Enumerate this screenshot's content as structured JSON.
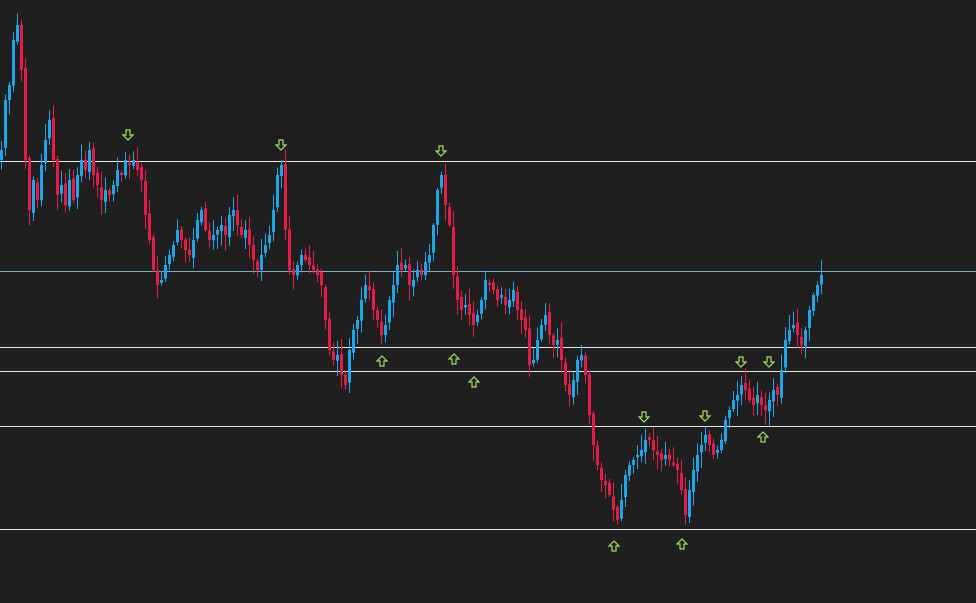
{
  "chart_data": {
    "type": "candlestick",
    "colors": {
      "background": "#1f1f1f",
      "bull": "#1ea7e8",
      "bear": "#e11d48",
      "level_line": "#e6e6e6",
      "mid_line": "#7fb0c8",
      "arrow": "#9fe35b"
    },
    "ylim": [
      0,
      603
    ],
    "horizontal_levels": [
      {
        "y": 161,
        "kind": "resistance"
      },
      {
        "y": 271,
        "kind": "mid"
      },
      {
        "y": 347,
        "kind": "support"
      },
      {
        "y": 371,
        "kind": "support"
      },
      {
        "y": 426,
        "kind": "support"
      },
      {
        "y": 529,
        "kind": "support"
      }
    ],
    "fractal_arrows": [
      {
        "x": 128,
        "y": 135,
        "dir": "down"
      },
      {
        "x": 281,
        "y": 145,
        "dir": "down"
      },
      {
        "x": 441,
        "y": 151,
        "dir": "down"
      },
      {
        "x": 382,
        "y": 361,
        "dir": "up"
      },
      {
        "x": 454,
        "y": 359,
        "dir": "up"
      },
      {
        "x": 474,
        "y": 382,
        "dir": "up"
      },
      {
        "x": 644,
        "y": 417,
        "dir": "down"
      },
      {
        "x": 705,
        "y": 416,
        "dir": "down"
      },
      {
        "x": 741,
        "y": 362,
        "dir": "down"
      },
      {
        "x": 769,
        "y": 362,
        "dir": "down"
      },
      {
        "x": 763,
        "y": 437,
        "dir": "up"
      },
      {
        "x": 614,
        "y": 546,
        "dir": "up"
      },
      {
        "x": 682,
        "y": 544,
        "dir": "up"
      }
    ],
    "price_path": [
      [
        0,
        150
      ],
      [
        4,
        100
      ],
      [
        8,
        85
      ],
      [
        12,
        40
      ],
      [
        16,
        25
      ],
      [
        20,
        70
      ],
      [
        24,
        160
      ],
      [
        28,
        210
      ],
      [
        32,
        180
      ],
      [
        36,
        200
      ],
      [
        40,
        165
      ],
      [
        44,
        140
      ],
      [
        48,
        120
      ],
      [
        52,
        160
      ],
      [
        56,
        195
      ],
      [
        60,
        185
      ],
      [
        64,
        205
      ],
      [
        68,
        180
      ],
      [
        72,
        200
      ],
      [
        76,
        175
      ],
      [
        80,
        160
      ],
      [
        84,
        170
      ],
      [
        88,
        150
      ],
      [
        92,
        175
      ],
      [
        96,
        185
      ],
      [
        100,
        200
      ],
      [
        104,
        190
      ],
      [
        108,
        195
      ],
      [
        112,
        185
      ],
      [
        116,
        170
      ],
      [
        120,
        175
      ],
      [
        124,
        160
      ],
      [
        128,
        165
      ],
      [
        132,
        160
      ],
      [
        136,
        170
      ],
      [
        140,
        180
      ],
      [
        144,
        215
      ],
      [
        148,
        240
      ],
      [
        152,
        270
      ],
      [
        156,
        285
      ],
      [
        160,
        280
      ],
      [
        164,
        265
      ],
      [
        168,
        255
      ],
      [
        172,
        245
      ],
      [
        176,
        230
      ],
      [
        180,
        240
      ],
      [
        184,
        250
      ],
      [
        188,
        255
      ],
      [
        192,
        240
      ],
      [
        196,
        220
      ],
      [
        200,
        210
      ],
      [
        204,
        230
      ],
      [
        208,
        240
      ],
      [
        212,
        235
      ],
      [
        216,
        230
      ],
      [
        220,
        225
      ],
      [
        224,
        235
      ],
      [
        228,
        215
      ],
      [
        232,
        210
      ],
      [
        236,
        225
      ],
      [
        240,
        235
      ],
      [
        244,
        230
      ],
      [
        248,
        245
      ],
      [
        252,
        260
      ],
      [
        256,
        270
      ],
      [
        260,
        255
      ],
      [
        264,
        245
      ],
      [
        268,
        235
      ],
      [
        272,
        210
      ],
      [
        276,
        175
      ],
      [
        280,
        165
      ],
      [
        284,
        230
      ],
      [
        288,
        270
      ],
      [
        292,
        275
      ],
      [
        296,
        265
      ],
      [
        300,
        255
      ],
      [
        304,
        260
      ],
      [
        308,
        265
      ],
      [
        312,
        270
      ],
      [
        316,
        275
      ],
      [
        320,
        285
      ],
      [
        324,
        320
      ],
      [
        328,
        350
      ],
      [
        332,
        360
      ],
      [
        336,
        355
      ],
      [
        340,
        375
      ],
      [
        344,
        385
      ],
      [
        348,
        350
      ],
      [
        352,
        330
      ],
      [
        356,
        320
      ],
      [
        360,
        300
      ],
      [
        364,
        285
      ],
      [
        368,
        290
      ],
      [
        372,
        310
      ],
      [
        376,
        320
      ],
      [
        380,
        335
      ],
      [
        384,
        325
      ],
      [
        388,
        300
      ],
      [
        392,
        285
      ],
      [
        396,
        265
      ],
      [
        400,
        270
      ],
      [
        404,
        265
      ],
      [
        408,
        285
      ],
      [
        412,
        280
      ],
      [
        416,
        270
      ],
      [
        420,
        275
      ],
      [
        424,
        262
      ],
      [
        428,
        255
      ],
      [
        432,
        225
      ],
      [
        436,
        190
      ],
      [
        440,
        175
      ],
      [
        444,
        205
      ],
      [
        448,
        225
      ],
      [
        452,
        275
      ],
      [
        456,
        300
      ],
      [
        460,
        310
      ],
      [
        464,
        305
      ],
      [
        468,
        315
      ],
      [
        472,
        325
      ],
      [
        476,
        315
      ],
      [
        480,
        300
      ],
      [
        484,
        280
      ],
      [
        488,
        285
      ],
      [
        492,
        290
      ],
      [
        496,
        300
      ],
      [
        500,
        295
      ],
      [
        504,
        305
      ],
      [
        508,
        300
      ],
      [
        512,
        290
      ],
      [
        516,
        310
      ],
      [
        520,
        320
      ],
      [
        524,
        330
      ],
      [
        528,
        365
      ],
      [
        532,
        360
      ],
      [
        536,
        340
      ],
      [
        540,
        325
      ],
      [
        544,
        315
      ],
      [
        548,
        335
      ],
      [
        552,
        345
      ],
      [
        556,
        340
      ],
      [
        560,
        360
      ],
      [
        564,
        385
      ],
      [
        568,
        395
      ],
      [
        572,
        380
      ],
      [
        576,
        360
      ],
      [
        580,
        355
      ],
      [
        584,
        375
      ],
      [
        588,
        415
      ],
      [
        592,
        445
      ],
      [
        596,
        465
      ],
      [
        600,
        480
      ],
      [
        604,
        485
      ],
      [
        608,
        495
      ],
      [
        612,
        510
      ],
      [
        616,
        520
      ],
      [
        620,
        500
      ],
      [
        624,
        475
      ],
      [
        628,
        465
      ],
      [
        632,
        460
      ],
      [
        636,
        455
      ],
      [
        640,
        450
      ],
      [
        644,
        440
      ],
      [
        648,
        440
      ],
      [
        652,
        450
      ],
      [
        656,
        455
      ],
      [
        660,
        460
      ],
      [
        664,
        455
      ],
      [
        668,
        460
      ],
      [
        672,
        465
      ],
      [
        676,
        470
      ],
      [
        680,
        490
      ],
      [
        684,
        515
      ],
      [
        688,
        490
      ],
      [
        692,
        470
      ],
      [
        696,
        455
      ],
      [
        700,
        445
      ],
      [
        704,
        435
      ],
      [
        708,
        445
      ],
      [
        712,
        455
      ],
      [
        716,
        450
      ],
      [
        720,
        440
      ],
      [
        724,
        420
      ],
      [
        728,
        410
      ],
      [
        732,
        400
      ],
      [
        736,
        395
      ],
      [
        740,
        385
      ],
      [
        744,
        390
      ],
      [
        748,
        400
      ],
      [
        752,
        405
      ],
      [
        756,
        395
      ],
      [
        760,
        405
      ],
      [
        764,
        410
      ],
      [
        768,
        400
      ],
      [
        772,
        390
      ],
      [
        776,
        395
      ],
      [
        780,
        370
      ],
      [
        784,
        340
      ],
      [
        788,
        330
      ],
      [
        792,
        325
      ],
      [
        796,
        335
      ],
      [
        800,
        345
      ],
      [
        804,
        330
      ],
      [
        808,
        310
      ],
      [
        812,
        295
      ],
      [
        816,
        285
      ],
      [
        820,
        275
      ]
    ]
  }
}
